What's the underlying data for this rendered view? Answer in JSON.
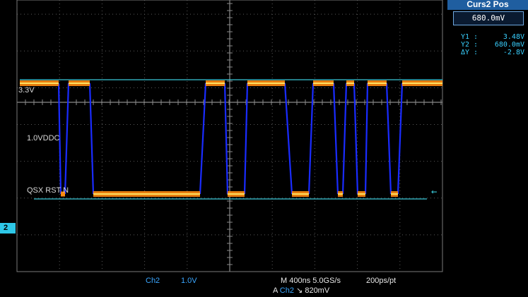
{
  "cursor_panel": {
    "title": "Curs2 Pos",
    "value": "680.0mV",
    "readouts": [
      {
        "label": "Y1 :",
        "value": "3.48V"
      },
      {
        "label": "Y2 :",
        "value": "680.0mV"
      },
      {
        "label": "ΔY :",
        "value": "-2.8V"
      }
    ]
  },
  "markers": {
    "ref_3v3": "3.3V",
    "ref_1v0": "1.0VDDC",
    "signal_name": "QSX RST N",
    "channel_marker": "2"
  },
  "status": {
    "channel": "Ch2",
    "scale": "1.0V",
    "timebase": "M 400ns 5.0GS/s",
    "record": "200ps/pt",
    "trigger_prefix": "A",
    "trigger_channel": "Ch2",
    "trigger_slope": "↘",
    "trigger_level": "820mV"
  },
  "colors": {
    "background": "#000000",
    "grid": "#5a5a5a",
    "trace_outer": "#ff8a10",
    "trace_inner": "#ffe060",
    "trace_edge": "#1a2cff",
    "cursor": "#39c8d8"
  }
}
